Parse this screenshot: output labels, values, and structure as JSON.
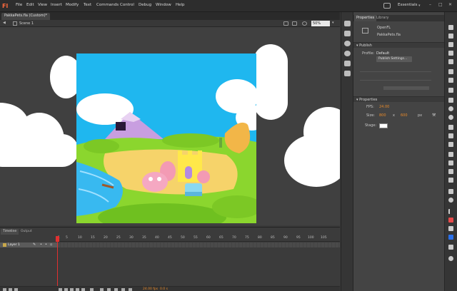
{
  "app": {
    "logo": "Fl",
    "menu": [
      "File",
      "Edit",
      "View",
      "Insert",
      "Modify",
      "Text",
      "Commands",
      "Control",
      "Debug",
      "Window",
      "Help"
    ],
    "workspace": "Essentials",
    "window_controls": [
      "–",
      "□",
      "✕"
    ]
  },
  "document": {
    "tab_title": "PakkaPets.fla (Custom)*",
    "scene_label": "Scene 1",
    "zoom": "50%"
  },
  "properties_panel": {
    "tabs": [
      "Properties",
      "Library"
    ],
    "doc_type": "OpenFL",
    "doc_name": "PakkaPets.fla",
    "publish_section": "Publish",
    "profile_label": "Profile:",
    "profile_value": "Default",
    "publish_settings_button": "Publish Settings...",
    "properties_section": "Properties",
    "fps_label": "FPS:",
    "fps_value": "24.00",
    "size_label": "Size:",
    "width": "800",
    "x_sep": "x",
    "height": "600",
    "units": "px",
    "stage_label": "Stage:",
    "stage_color": "#ffffff"
  },
  "timeline": {
    "tabs": [
      "Timeline",
      "Output"
    ],
    "frame_numbers": [
      "1",
      "5",
      "10",
      "15",
      "20",
      "25",
      "30",
      "35",
      "40",
      "45",
      "50",
      "55",
      "60",
      "65",
      "70",
      "75",
      "80",
      "85",
      "90",
      "95",
      "100",
      "105"
    ],
    "layer_name": "Layer 1",
    "fps_readout": "24.00 fps",
    "time_readout": "0.0 s"
  },
  "colors": {
    "accent_orange": "#e88a2a",
    "playhead": "#e03030",
    "sky": "#1fb7ef",
    "grass": "#8bd62e"
  }
}
